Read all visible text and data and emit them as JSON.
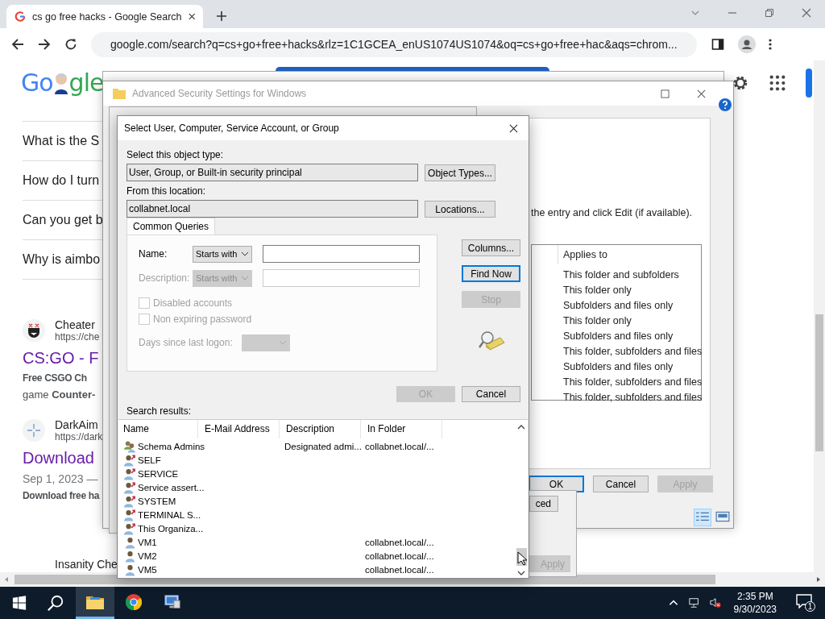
{
  "browser": {
    "tab": {
      "title": "cs go free hacks - Google Search",
      "selected": true
    },
    "url": "google.com/search?q=cs+go+free+hacks&rlz=1C1GCEA_enUS1074US1074&oq=cs+go+free+hac&aqs=chrom..."
  },
  "google": {
    "logo": [
      "Go",
      "gle"
    ],
    "questions": [
      "What is the S",
      "How do I turn",
      "Can you get b",
      "Why is aimbo"
    ],
    "results": [
      {
        "kind": "mask",
        "site": "Cheater",
        "url": "https://che",
        "title": "CS:GO - F",
        "lines": [
          {
            "text": "Free CSGO Ch",
            "bold": true
          },
          {
            "text": "game **Counter-**",
            "bold": false
          }
        ]
      },
      {
        "kind": "crosshair",
        "site": "DarkAim",
        "url": "https://dark",
        "title": "Download",
        "date": "Sep 1, 2023 —",
        "lines": [
          {
            "text": "Download free ha",
            "bold": true
          }
        ]
      }
    ],
    "next_site": "Insanity Che"
  },
  "advanced": {
    "title": "Advanced Security Settings for Windows",
    "instruction": "the entry and click Edit (if available).",
    "column": "Applies to",
    "rows": [
      "This folder and subfolders",
      "This folder only",
      "Subfolders and files only",
      "This folder only",
      "Subfolders and files only",
      "This folder, subfolders and files",
      "Subfolders and files only",
      "This folder, subfolders and files",
      "This folder, subfolders and files"
    ],
    "buttons": [
      {
        "label": "OK",
        "default": true,
        "disabled": false
      },
      {
        "label": "Cancel",
        "default": false,
        "disabled": false
      },
      {
        "label": "Apply",
        "default": false,
        "disabled": true
      }
    ]
  },
  "behind": {
    "buttons": [
      {
        "label": "ced",
        "disabled": false
      },
      {
        "label": "Apply",
        "disabled": true
      }
    ]
  },
  "dialog": {
    "title": "Select User, Computer, Service Account, or Group",
    "type_label": "Select this object type:",
    "type_value": "User, Group, or Built-in security principal",
    "type_button": "Object Types...",
    "location_label": "From this location:",
    "location_value": "collabnet.local",
    "location_button": "Locations...",
    "tab": {
      "label": "Common Queries",
      "selected": true
    },
    "name": {
      "label": "Name:",
      "match": "Starts with",
      "disabled": false
    },
    "description": {
      "label": "Description:",
      "match": "Starts with",
      "disabled": true
    },
    "checkboxes": [
      {
        "label": "Disabled accounts",
        "checked": false,
        "disabled": true
      },
      {
        "label": "Non expiring password",
        "checked": false,
        "disabled": true
      }
    ],
    "days": {
      "label": "Days since last logon:",
      "disabled": true
    },
    "side_buttons": [
      {
        "label": "Columns...",
        "default": false,
        "disabled": false
      },
      {
        "label": "Find Now",
        "default": true,
        "disabled": false
      },
      {
        "label": "Stop",
        "default": false,
        "disabled": true
      }
    ],
    "buttons": [
      {
        "label": "OK",
        "default": false,
        "disabled": true
      },
      {
        "label": "Cancel",
        "default": false,
        "disabled": false
      }
    ],
    "results_label": "Search results:",
    "columns": [
      "Name",
      "E-Mail Address",
      "Description",
      "In Folder"
    ],
    "rows": [
      {
        "kind": "group",
        "name": "Schema Admins",
        "description": "Designated admi...",
        "folder": "collabnet.local/..."
      },
      {
        "kind": "principal",
        "name": "SELF"
      },
      {
        "kind": "principal",
        "name": "SERVICE"
      },
      {
        "kind": "principal",
        "name": "Service assert..."
      },
      {
        "kind": "principal",
        "name": "SYSTEM"
      },
      {
        "kind": "principal",
        "name": "TERMINAL S..."
      },
      {
        "kind": "principal",
        "name": "This Organiza..."
      },
      {
        "kind": "user",
        "name": "VM1",
        "folder": "collabnet.local/..."
      },
      {
        "kind": "user",
        "name": "VM2",
        "folder": "collabnet.local/..."
      },
      {
        "kind": "user",
        "name": "VM5",
        "folder": "collabnet.local/..."
      }
    ]
  },
  "taskbar": {
    "apps": [
      {
        "kind": "explorer",
        "selected": true
      },
      {
        "kind": "chrome",
        "selected": false
      },
      {
        "kind": "network",
        "selected": false
      }
    ],
    "time": "2:35 PM",
    "date": "9/30/2023",
    "notifications": "1"
  }
}
